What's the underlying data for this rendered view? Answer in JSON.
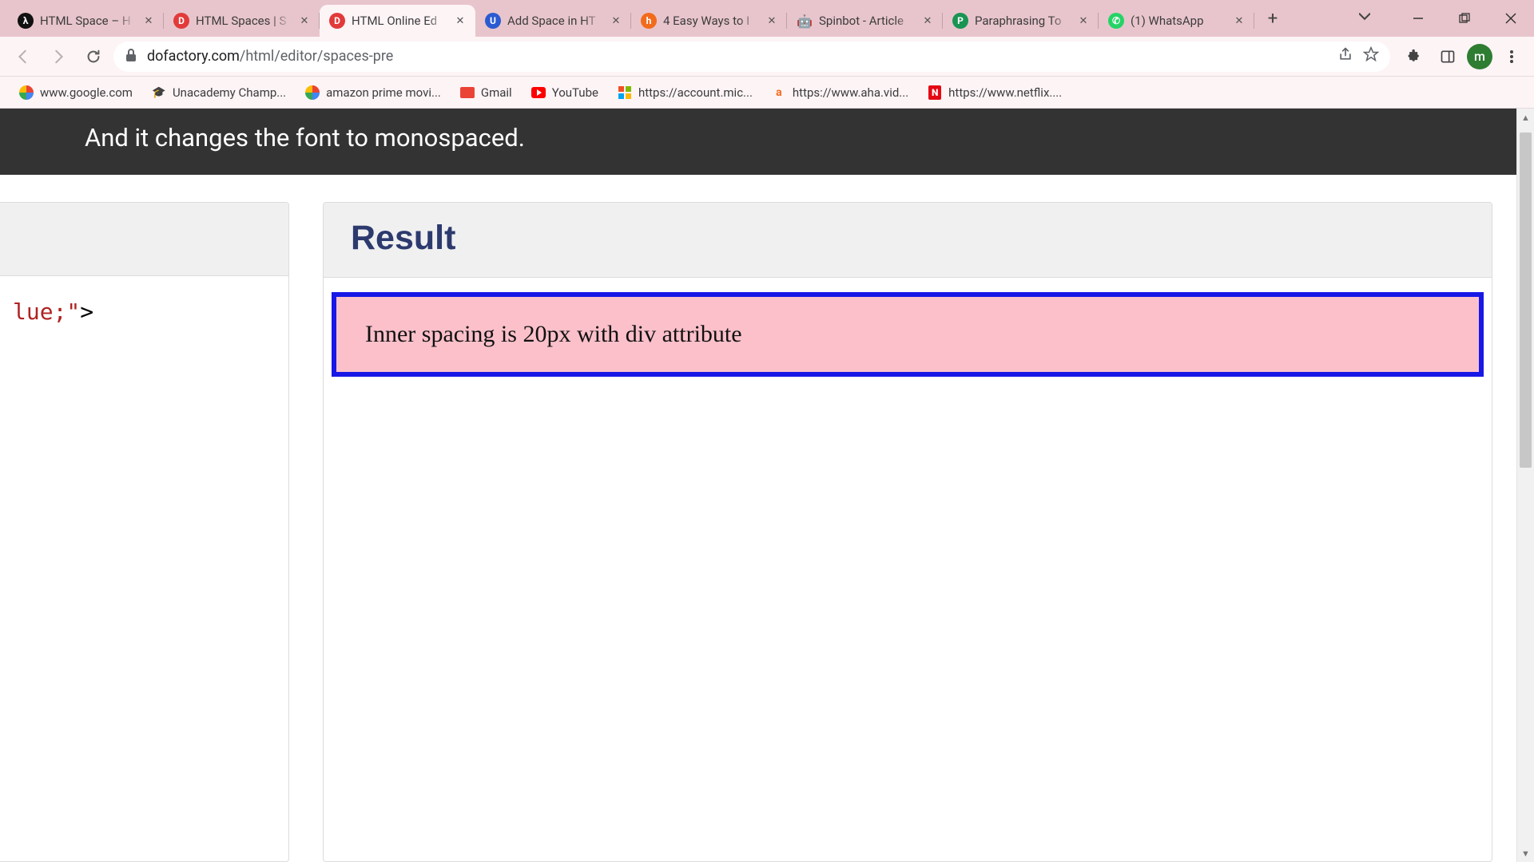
{
  "tabs": [
    {
      "title": "HTML Space – H"
    },
    {
      "title": "HTML Spaces | S"
    },
    {
      "title": "HTML Online Ed"
    },
    {
      "title": "Add Space in HT"
    },
    {
      "title": "4 Easy Ways to I"
    },
    {
      "title": "Spinbot - Article"
    },
    {
      "title": "Paraphrasing To"
    },
    {
      "title": "(1) WhatsApp"
    }
  ],
  "url": {
    "host": "dofactory.com",
    "path": "/html/editor/spaces-pre"
  },
  "avatar_letter": "m",
  "bookmarks": [
    {
      "label": "www.google.com"
    },
    {
      "label": "Unacademy Champ..."
    },
    {
      "label": "amazon prime movi..."
    },
    {
      "label": "Gmail"
    },
    {
      "label": "YouTube"
    },
    {
      "label": "https://account.mic..."
    },
    {
      "label": "https://www.aha.vid..."
    },
    {
      "label": "https://www.netflix...."
    }
  ],
  "banner_text": "And it changes the font to monospaced.",
  "code_fragment": "lue;\">",
  "result": {
    "heading": "Result",
    "demo_text": "Inner spacing is 20px with div attribute"
  }
}
